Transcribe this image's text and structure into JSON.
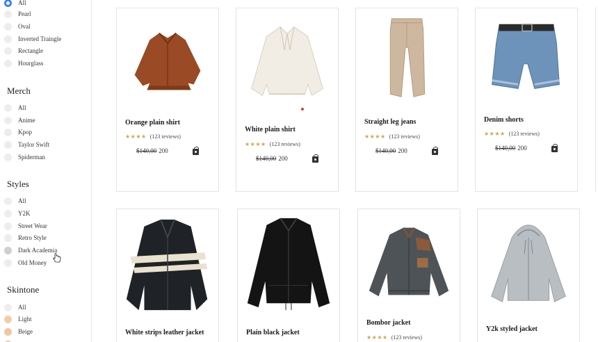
{
  "filters": {
    "shape_options": [
      "All",
      "Pearl",
      "Oval",
      "Inverted Traingle",
      "Rectangle",
      "Hourglass"
    ],
    "merch": {
      "title": "Merch",
      "options": [
        "All",
        "Anime",
        "Kpop",
        "Taylor Swift",
        "Spiderman"
      ]
    },
    "styles": {
      "title": "Styles",
      "options": [
        "All",
        "Y2K",
        "Street Wear",
        "Retro Style",
        "Dark Academia",
        "Old Money"
      ]
    },
    "skintone": {
      "title": "Skintone",
      "options": [
        "All",
        "Light",
        "Beige"
      ]
    }
  },
  "products": [
    {
      "name": "Orange plain shirt",
      "reviews": "(123 reviews)",
      "old_price": "$140,00",
      "price": "200",
      "rating": 4
    },
    {
      "name": "White plain shirt",
      "reviews": "(123 reviews)",
      "old_price": "$140,00",
      "price": "200",
      "rating": 4
    },
    {
      "name": "Straight leg jeans",
      "reviews": "(123 reviews)",
      "old_price": "$140,00",
      "price": "200",
      "rating": 4
    },
    {
      "name": "Denim shorts",
      "reviews": "(123 reviews)",
      "old_price": "$140,00",
      "price": "200",
      "rating": 4
    },
    {
      "name": "White strips leather jacket"
    },
    {
      "name": "Plain black jacket"
    },
    {
      "name": "Bombor jacket",
      "reviews": "(123 reviews)",
      "rating": 4
    },
    {
      "name": "Y2k styled jacket"
    }
  ],
  "stars": "★★★★",
  "colors": {
    "accent": "#3b82f6",
    "star": "#d4a24c"
  }
}
